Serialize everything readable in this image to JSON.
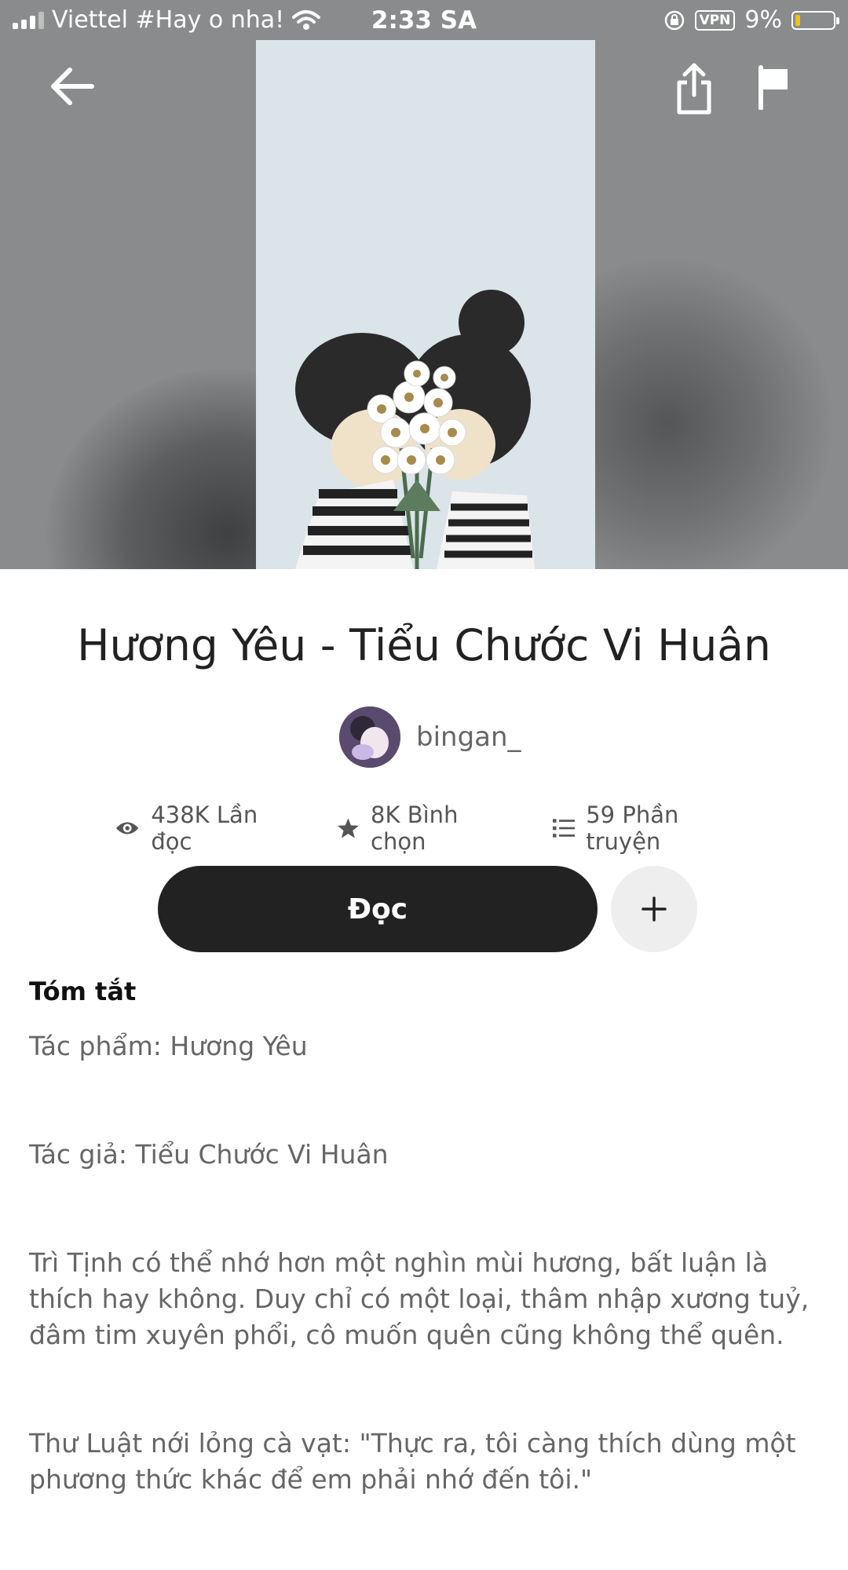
{
  "status_bar": {
    "carrier": "Viettel #Hay o nha!",
    "time": "2:33 SA",
    "vpn": "VPN",
    "battery": "9%"
  },
  "story": {
    "title": "Hương Yêu - Tiểu Chước Vi Huân",
    "author": "bingan_",
    "stats": {
      "reads": "438K Lần đọc",
      "votes": "8K Bình chọn",
      "parts": "59 Phần truyện"
    },
    "read_button": "Đọc",
    "summary_title": "Tóm tắt",
    "summary": [
      "Tác phẩm: Hương Yêu",
      "Tác giả: Tiểu Chước Vi Huân",
      "Trì Tịnh có thể nhớ hơn một nghìn mùi hương, bất luận là thích hay không. Duy chỉ có một loại, thâm nhập xương tuỷ, đâm tim xuyên phổi, cô muốn quên cũng không thể quên.",
      "Thư Luật nới lỏng cà vạt: \"Thực ra, tôi càng thích dùng một phương thức khác để em phải nhớ đến tôi.\""
    ]
  },
  "icons": {
    "back": "arrow-left-icon",
    "share": "share-icon",
    "report": "flag-icon",
    "add": "plus-icon",
    "reads": "eye-icon",
    "votes": "star-icon",
    "parts": "list-icon"
  },
  "colors": {
    "header_bg": "#8a8b8c",
    "button_dark": "#222222",
    "battery_low": "#f4c20d"
  }
}
